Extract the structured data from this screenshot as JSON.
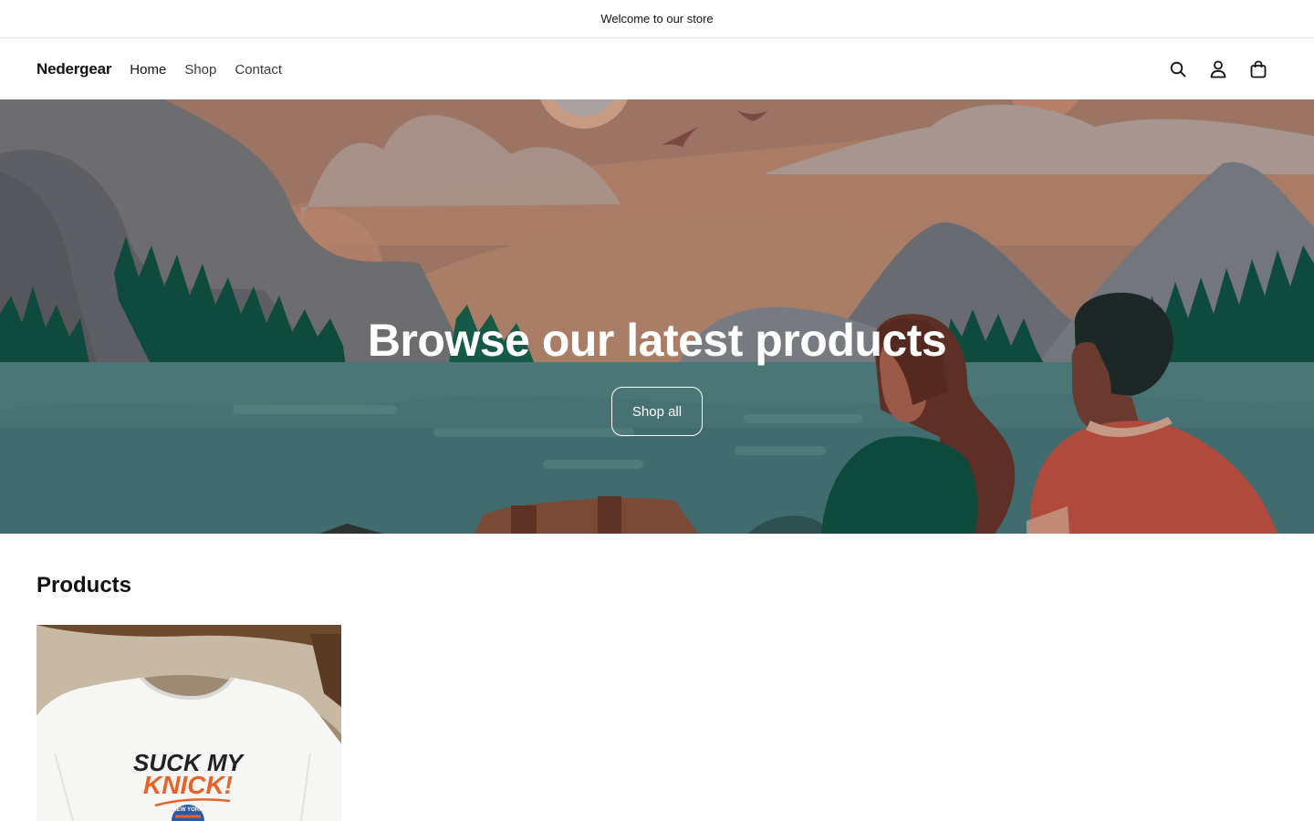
{
  "announcement": {
    "text": "Welcome to our store"
  },
  "header": {
    "logo": "Nedergear",
    "nav": [
      {
        "label": "Home"
      },
      {
        "label": "Shop"
      },
      {
        "label": "Contact"
      }
    ],
    "icons": [
      "search-icon",
      "account-icon",
      "cart-icon"
    ]
  },
  "hero": {
    "title": "Browse our latest products",
    "button_label": "Shop all"
  },
  "products": {
    "title": "Products",
    "items": [
      {
        "image_text_line1": "SUCK MY",
        "image_text_line2": "KNICK!",
        "image_text_line3": "NEW YORK"
      }
    ]
  },
  "colors": {
    "text": "#121212",
    "hero_water": "#3f6b6e",
    "hero_sky": "#a77b66"
  }
}
